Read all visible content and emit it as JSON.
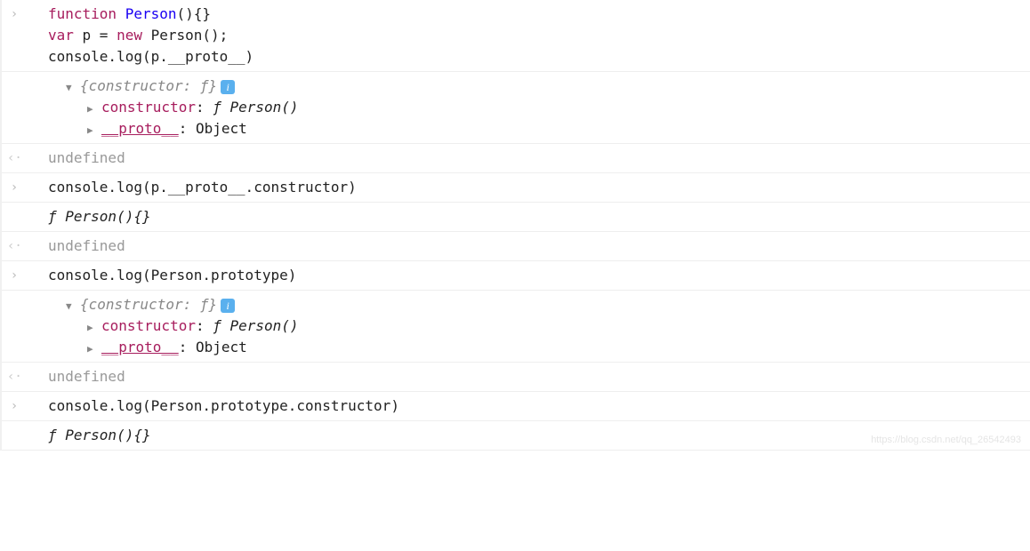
{
  "blocks": [
    {
      "type": "input",
      "lines": [
        {
          "tokens": [
            {
              "t": "function",
              "cls": "kw"
            },
            {
              "t": " "
            },
            {
              "t": "Person",
              "cls": "fn-name"
            },
            {
              "t": "(){}",
              "cls": "punct"
            }
          ]
        },
        {
          "tokens": [
            {
              "t": "var",
              "cls": "var-kw"
            },
            {
              "t": " p = "
            },
            {
              "t": "new",
              "cls": "new-kw"
            },
            {
              "t": " Person();"
            }
          ]
        },
        {
          "tokens": [
            {
              "t": "console.log(p.__proto__)"
            }
          ]
        }
      ],
      "tree": {
        "summary_tokens": [
          {
            "t": "{constructor: ƒ}",
            "cls": "italic muted"
          }
        ],
        "info_badge": "i",
        "children": [
          {
            "tokens": [
              {
                "t": "constructor",
                "cls": "prop-key"
              },
              {
                "t": ": "
              },
              {
                "t": "ƒ Person()",
                "cls": "italic"
              }
            ]
          },
          {
            "tokens": [
              {
                "t": "__proto__",
                "cls": "proto-link"
              },
              {
                "t": ": Object"
              }
            ]
          }
        ]
      }
    },
    {
      "type": "return",
      "value": "undefined"
    },
    {
      "type": "input",
      "lines": [
        {
          "tokens": [
            {
              "t": "console.log(p.__proto__.constructor)"
            }
          ]
        }
      ],
      "output_tokens": [
        {
          "t": "ƒ Person(){}",
          "cls": "italic"
        }
      ]
    },
    {
      "type": "return",
      "value": "undefined"
    },
    {
      "type": "input",
      "lines": [
        {
          "tokens": [
            {
              "t": "console.log(Person.prototype)"
            }
          ]
        }
      ],
      "tree": {
        "summary_tokens": [
          {
            "t": "{constructor: ƒ}",
            "cls": "italic muted"
          }
        ],
        "info_badge": "i",
        "children": [
          {
            "tokens": [
              {
                "t": "constructor",
                "cls": "prop-key"
              },
              {
                "t": ": "
              },
              {
                "t": "ƒ Person()",
                "cls": "italic"
              }
            ]
          },
          {
            "tokens": [
              {
                "t": "__proto__",
                "cls": "proto-link"
              },
              {
                "t": ": Object"
              }
            ]
          }
        ]
      }
    },
    {
      "type": "return",
      "value": "undefined"
    },
    {
      "type": "input",
      "lines": [
        {
          "tokens": [
            {
              "t": "console.log(Person.prototype.constructor)"
            }
          ]
        }
      ],
      "output_tokens": [
        {
          "t": "ƒ Person(){}",
          "cls": "italic"
        }
      ]
    }
  ],
  "glyphs": {
    "input": "›",
    "return": "‹·",
    "expand_open": "▼",
    "expand_closed": "▶"
  },
  "watermark": "https://blog.csdn.net/qq_26542493"
}
